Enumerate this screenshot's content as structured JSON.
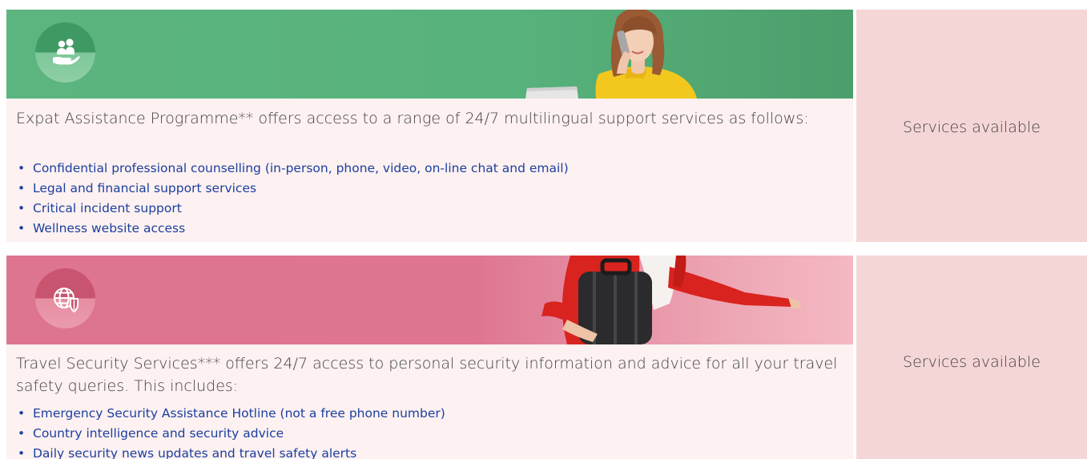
{
  "sections": [
    {
      "icon": "hands-holding-people-icon",
      "description": "Expat Assistance Programme** offers access to a range of 24/7 multilingual support services as follows:",
      "items": [
        "Confidential professional counselling (in-person, phone, video, on-line chat and email)",
        "Legal and financial support services",
        "Critical incident support",
        "Wellness website access"
      ],
      "status": "Services available"
    },
    {
      "icon": "globe-shield-icon",
      "description": "Travel Security Services*** offers 24/7 access to personal security information and advice for all your travel safety queries. This includes:",
      "items": [
        "Emergency Security Assistance Hotline (not a free phone number)",
        "Country intelligence and security advice",
        "Daily security news updates and travel safety alerts"
      ],
      "status": "Services available"
    }
  ],
  "colors": {
    "green_banner": "#5cb57f",
    "pink_banner": "#dd7590",
    "panel_bg": "#fdf1f1",
    "side_bg": "#f5d6d6",
    "link_blue": "#1c3fa0"
  }
}
